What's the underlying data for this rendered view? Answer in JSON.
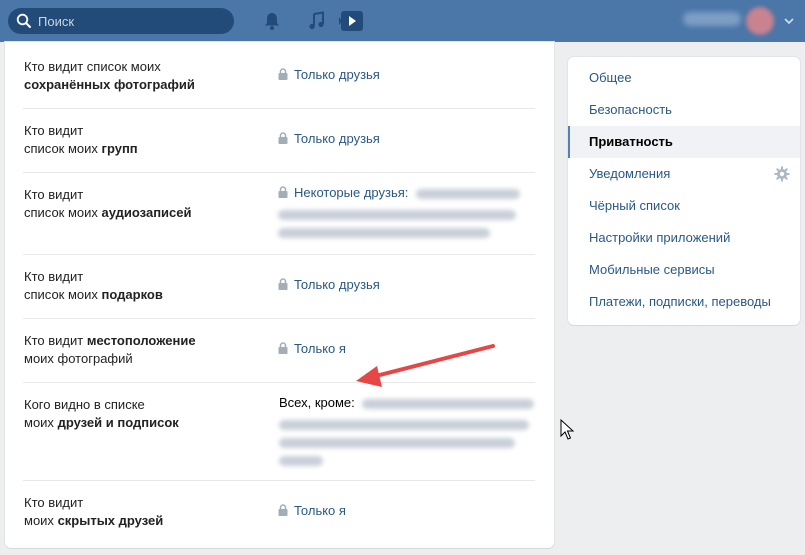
{
  "header": {
    "search_placeholder": "Поиск",
    "icons": [
      "search-icon",
      "bell-icon",
      "music-icon",
      "play-icon",
      "avatar",
      "chevron-down-icon"
    ]
  },
  "settings": {
    "rows": [
      {
        "label_prefix": "Кто видит список моих",
        "label_bold": "сохранённых фотографий",
        "value": "Только друзья"
      },
      {
        "label_prefix": "Кто видит",
        "label_mid": "список моих",
        "label_bold": "групп",
        "value": "Только друзья"
      },
      {
        "label_prefix": "Кто видит",
        "label_mid": "список моих",
        "label_bold": "аудиозаписей",
        "value": "Некоторые друзья:"
      },
      {
        "label_prefix": "Кто видит",
        "label_mid": "список моих",
        "label_bold": "подарков",
        "value": "Только друзья"
      },
      {
        "label_prefix": "Кто видит",
        "label_bold": "местоположение",
        "label_suffix": "моих фотографий",
        "value": "Только я"
      },
      {
        "label_prefix": "Кого видно в списке",
        "label_mid": "моих",
        "label_bold": "друзей и подписок",
        "value": "Всех, кроме:"
      },
      {
        "label_prefix": "Кто видит",
        "label_mid": "моих",
        "label_bold": "скрытых друзей",
        "value": "Только я"
      }
    ]
  },
  "sidebar": {
    "items": [
      {
        "label": "Общее"
      },
      {
        "label": "Безопасность"
      },
      {
        "label": "Приватность",
        "active": true
      },
      {
        "label": "Уведомления"
      },
      {
        "label": "Чёрный список"
      },
      {
        "label": "Настройки приложений"
      },
      {
        "label": "Мобильные сервисы"
      },
      {
        "label": "Платежи, подписки, переводы"
      }
    ]
  },
  "colors": {
    "header": "#4a76a8",
    "link": "#2a5885",
    "arrow": "#e64646",
    "active_border": "#5181b8"
  }
}
